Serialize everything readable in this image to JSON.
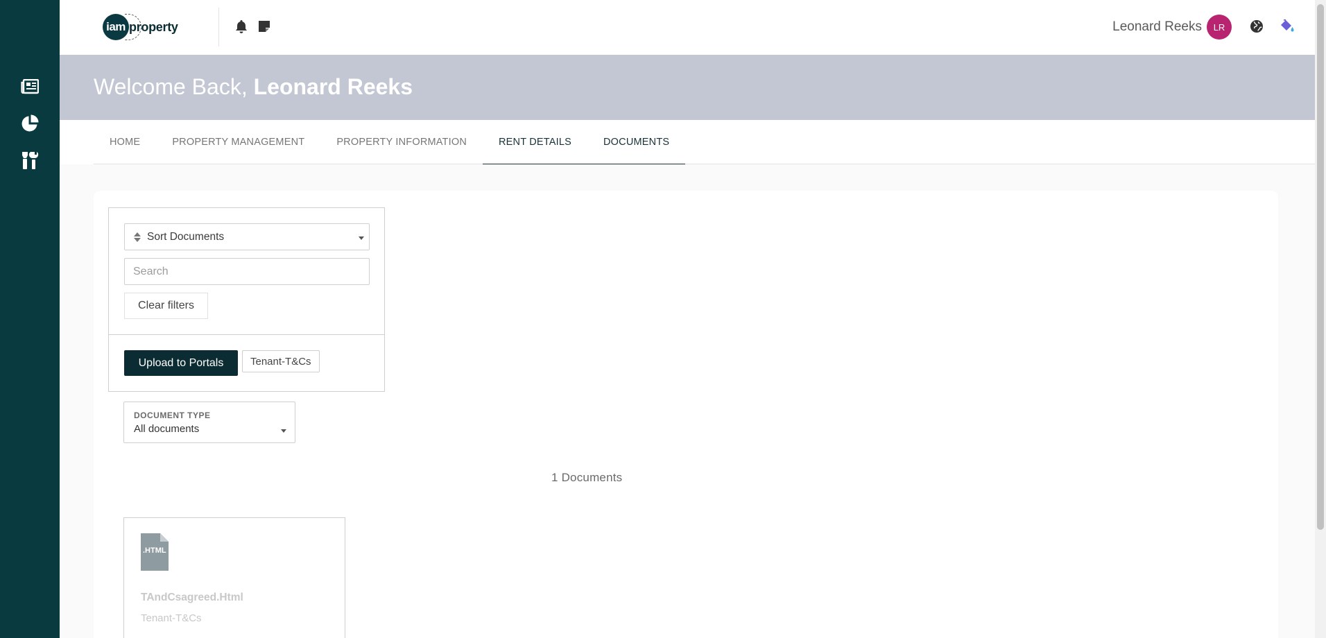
{
  "sidebar": {
    "icons": [
      "newspaper-icon",
      "pie-chart-icon",
      "tools-icon"
    ]
  },
  "header": {
    "logo_left": "iam",
    "logo_right": "property",
    "icons": [
      "bell-icon",
      "note-icon",
      "globe-icon",
      "paint-bucket-icon"
    ],
    "user_name": "Leonard Reeks",
    "avatar_initials": "LR"
  },
  "banner": {
    "greeting": "Welcome Back,",
    "name": "Leonard Reeks"
  },
  "tabs": [
    {
      "label": "HOME",
      "active": false
    },
    {
      "label": "PROPERTY MANAGEMENT",
      "active": false
    },
    {
      "label": "PROPERTY INFORMATION",
      "active": false
    },
    {
      "label": "RENT DETAILS",
      "active": true
    },
    {
      "label": "DOCUMENTS",
      "active": true
    }
  ],
  "filters": {
    "sort_label": "Sort Documents",
    "search_placeholder": "Search",
    "search_value": "",
    "clear_label": "Clear filters",
    "upload_label": "Upload to Portals",
    "tag_chip": "Tenant-T&Cs"
  },
  "document_type": {
    "label": "DOCUMENT TYPE",
    "value": "All documents"
  },
  "documents": {
    "count_text": "1 Documents",
    "items": [
      {
        "file_ext": ".HTML",
        "name": "TAndCsagreed.Html",
        "tag": "Tenant-T&Cs"
      }
    ]
  },
  "colors": {
    "rail": "#083a40",
    "banner": "#c3c7d3",
    "primary_button": "#0b2c33",
    "avatar": "#b8246f"
  }
}
